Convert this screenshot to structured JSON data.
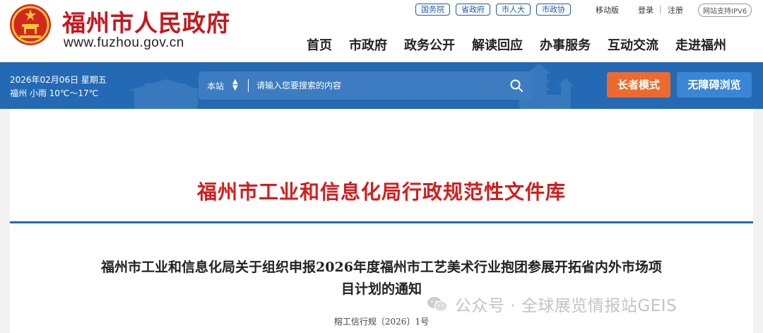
{
  "header": {
    "site_title": "福州市人民政府",
    "site_domain": "www.fuzhou.gov.cn",
    "top_links": [
      "国务院",
      "省政府",
      "市人大",
      "市政协"
    ],
    "mobile": "移动版",
    "login": "登录",
    "separator": "|",
    "register": "注册",
    "ipv6": "网站支持IPV6",
    "nav": [
      "首页",
      "市政府",
      "政务公开",
      "解读回应",
      "办事服务",
      "互动交流",
      "走进福州"
    ]
  },
  "banner": {
    "date": "2026年02月06日 星期五",
    "weather": "福州 小雨 10℃～17℃",
    "search_scope": "本站",
    "search_placeholder": "请输入您要搜索的内容",
    "elder_mode": "长者模式",
    "accessible": "无障碍浏览"
  },
  "content": {
    "library_title": "福州市工业和信息化局行政规范性文件库",
    "doc_title_line1": "福州市工业和信息化局关于组织申报2026年度福州市工艺美术行业抱团参展开拓省内外市场项",
    "doc_title_line2": "目计划的通知",
    "doc_number": "榕工信行规〔2026〕1号"
  },
  "watermark": {
    "text": "公众号 · 全球展览情报站GEIS"
  },
  "colors": {
    "brand_red": "#c8161d",
    "banner_blue": "#2469b3",
    "elder_orange": "#ec6a2e",
    "access_blue": "#3b86d4"
  },
  "icons": [
    "national-emblem-icon",
    "search-icon",
    "wechat-icon"
  ]
}
